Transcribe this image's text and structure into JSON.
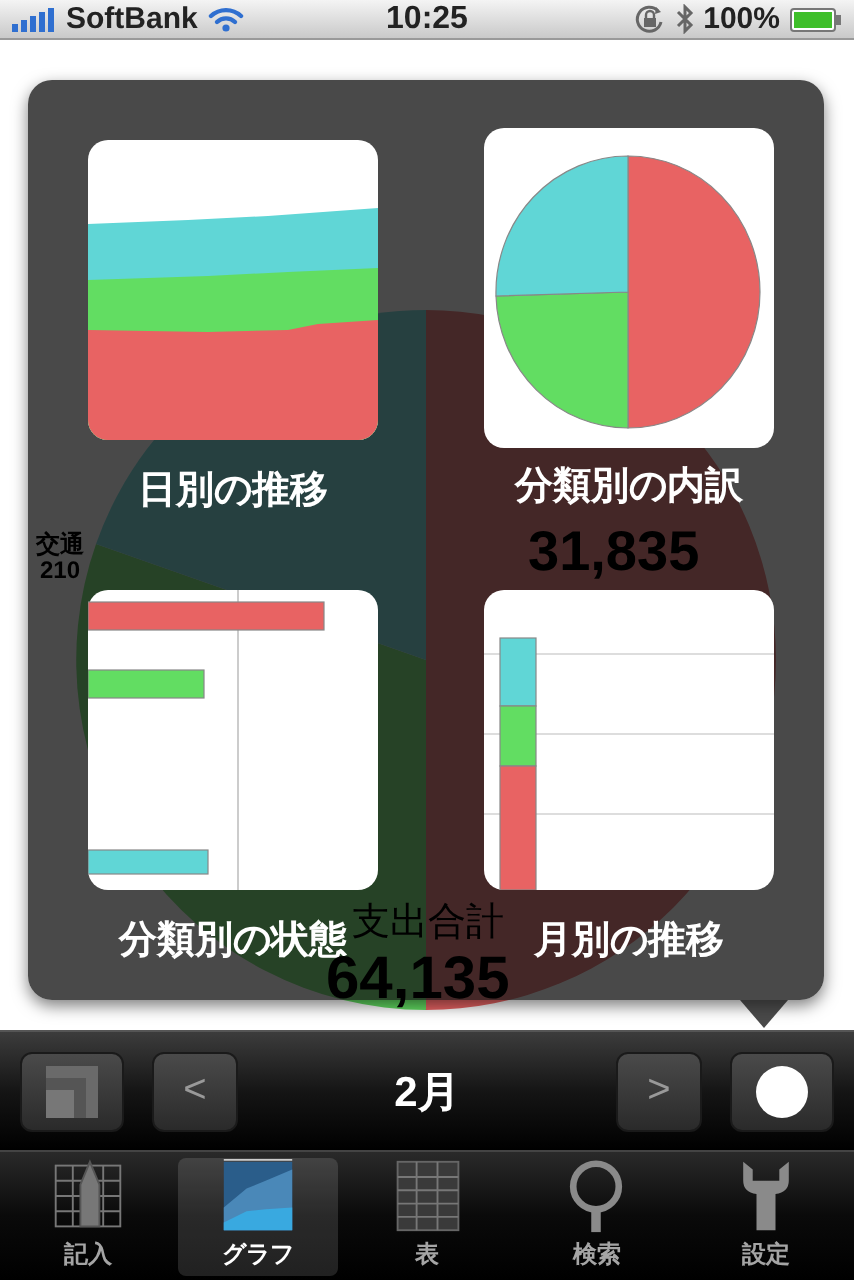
{
  "status_bar": {
    "carrier": "SoftBank",
    "time": "10:25",
    "battery": "100%"
  },
  "background_chart": {
    "labels": [
      {
        "name": "交通",
        "value": "210"
      }
    ],
    "slice_value": "31,835",
    "total_label": "支出合計",
    "total": "64,135"
  },
  "popover": {
    "items": [
      {
        "kind": "area",
        "label": "日別の推移"
      },
      {
        "kind": "pie",
        "label": "分類別の内訳"
      },
      {
        "kind": "hbar",
        "label": "分類別の状態"
      },
      {
        "kind": "vbar",
        "label": "月別の推移"
      }
    ]
  },
  "toolbar": {
    "prev": "<",
    "month": "2月",
    "next": ">"
  },
  "tabs": [
    {
      "kind": "entry",
      "label": "記入",
      "selected": false
    },
    {
      "kind": "graph",
      "label": "グラフ",
      "selected": true
    },
    {
      "kind": "table",
      "label": "表",
      "selected": false
    },
    {
      "kind": "search",
      "label": "検索",
      "selected": false
    },
    {
      "kind": "settings",
      "label": "設定",
      "selected": false
    }
  ]
}
